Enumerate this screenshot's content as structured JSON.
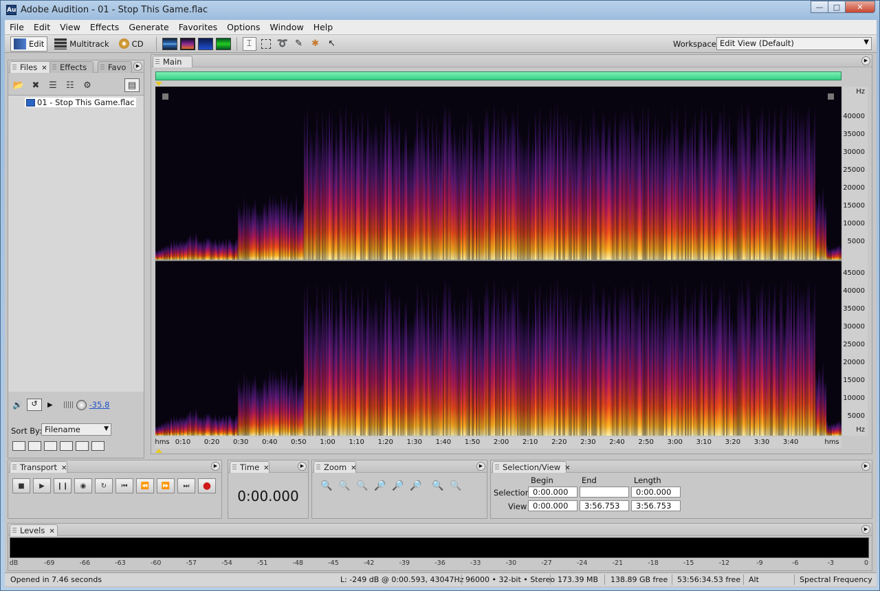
{
  "window": {
    "title": "Adobe Audition - 01 - Stop This Game.flac",
    "app_icon": "Au"
  },
  "menu": [
    "File",
    "Edit",
    "View",
    "Effects",
    "Generate",
    "Favorites",
    "Options",
    "Window",
    "Help"
  ],
  "toolbar": {
    "edit_label": "Edit",
    "multitrack_label": "Multitrack",
    "cd_label": "CD",
    "workspace_label": "Workspace:",
    "workspace_value": "Edit View (Default)"
  },
  "files_panel": {
    "tabs": [
      "Files",
      "Effects",
      "Favo"
    ],
    "file_name": "01 - Stop This Game.flac",
    "volume_value": "-35.8",
    "sort_label": "Sort By:",
    "sort_value": "Filename"
  },
  "editor": {
    "tab": "Main",
    "hz_unit": "Hz",
    "top_channel_hz": [
      "40000",
      "35000",
      "30000",
      "25000",
      "20000",
      "15000",
      "10000",
      "5000"
    ],
    "bottom_channel_hz": [
      "45000",
      "40000",
      "35000",
      "30000",
      "25000",
      "20000",
      "15000",
      "10000",
      "5000",
      "Hz"
    ],
    "time_unit": "hms",
    "time_ticks": [
      "0:10",
      "0:20",
      "0:30",
      "0:40",
      "0:50",
      "1:00",
      "1:10",
      "1:20",
      "1:30",
      "1:40",
      "1:50",
      "2:00",
      "2:10",
      "2:20",
      "2:30",
      "2:40",
      "2:50",
      "3:00",
      "3:10",
      "3:20",
      "3:30",
      "3:40"
    ],
    "time_unit_right": "hms"
  },
  "transport": {
    "tab": "Transport"
  },
  "time_panel": {
    "tab": "Time",
    "value": "0:00.000"
  },
  "zoom_panel": {
    "tab": "Zoom"
  },
  "selection": {
    "tab": "Selection/View",
    "headers": [
      "Begin",
      "End",
      "Length"
    ],
    "selection_label": "Selection",
    "view_label": "View",
    "selection_begin": "0:00.000",
    "selection_end": "",
    "selection_length": "0:00.000",
    "view_begin": "0:00.000",
    "view_end": "3:56.753",
    "view_length": "3:56.753"
  },
  "levels": {
    "tab": "Levels",
    "scale": [
      "dB",
      "-69",
      "-66",
      "-63",
      "-60",
      "-57",
      "-54",
      "-51",
      "-48",
      "-45",
      "-42",
      "-39",
      "-36",
      "-33",
      "-30",
      "-27",
      "-24",
      "-21",
      "-18",
      "-15",
      "-12",
      "-9",
      "-6",
      "-3",
      "0"
    ]
  },
  "status": {
    "opened": "Opened in 7.46 seconds",
    "cursor": "L: -249 dB @   0:00.593, 43047Hz",
    "format": "96000 • 32-bit • Stereo",
    "size": "173.39 MB",
    "free": "138.89 GB free",
    "free_time": "53:56:34.53 free",
    "alt": "Alt",
    "mode": "Spectral Frequency"
  },
  "colors": {
    "overview": "#3fdc8f",
    "spectro_bg": "#000000",
    "accent": "#2250c8"
  }
}
